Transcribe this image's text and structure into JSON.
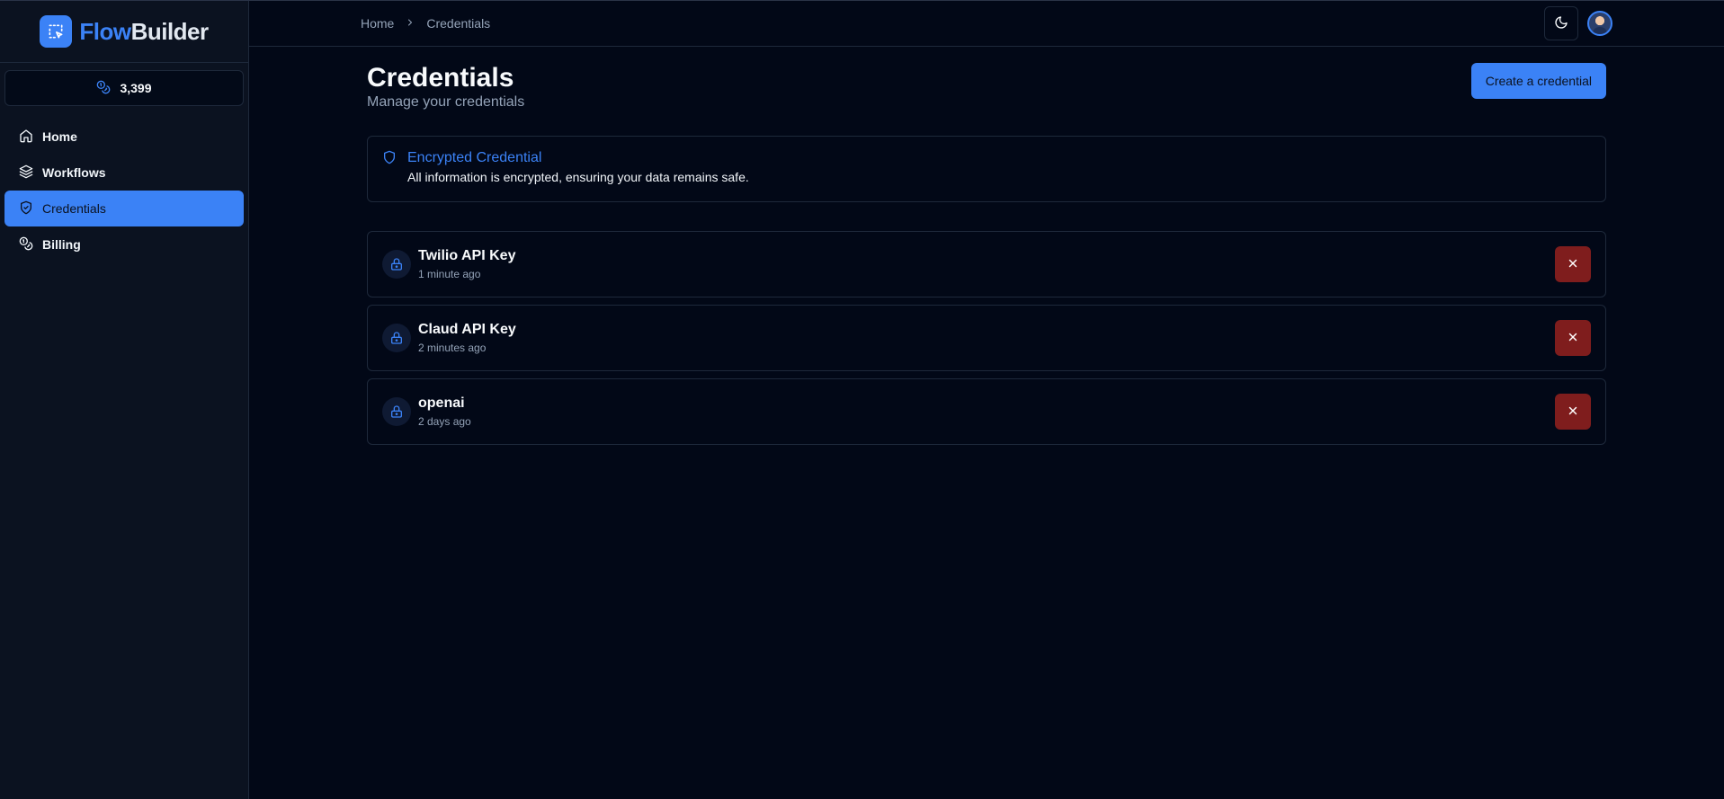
{
  "brand": {
    "part1": "Flow",
    "part2": "Builder"
  },
  "credits": {
    "balance": "3,399"
  },
  "sidebar": {
    "items": [
      {
        "label": "Home",
        "icon": "home-icon",
        "active": false
      },
      {
        "label": "Workflows",
        "icon": "layers-icon",
        "active": false
      },
      {
        "label": "Credentials",
        "icon": "shield-icon",
        "active": true
      },
      {
        "label": "Billing",
        "icon": "coins-icon",
        "active": false
      }
    ]
  },
  "breadcrumb": {
    "items": [
      "Home",
      "Credentials"
    ]
  },
  "page": {
    "title": "Credentials",
    "subtitle": "Manage your credentials",
    "create_label": "Create a credential"
  },
  "alert": {
    "title": "Encrypted Credential",
    "description": "All information is encrypted, ensuring your data remains safe."
  },
  "credentials": [
    {
      "name": "Twilio API Key",
      "time": "1 minute ago"
    },
    {
      "name": "Claud API Key",
      "time": "2 minutes ago"
    },
    {
      "name": "openai",
      "time": "2 days ago"
    }
  ],
  "colors": {
    "accent": "#3b82f6",
    "background": "#020817",
    "sidebar": "#0b1220",
    "danger": "#7f1d1d"
  }
}
